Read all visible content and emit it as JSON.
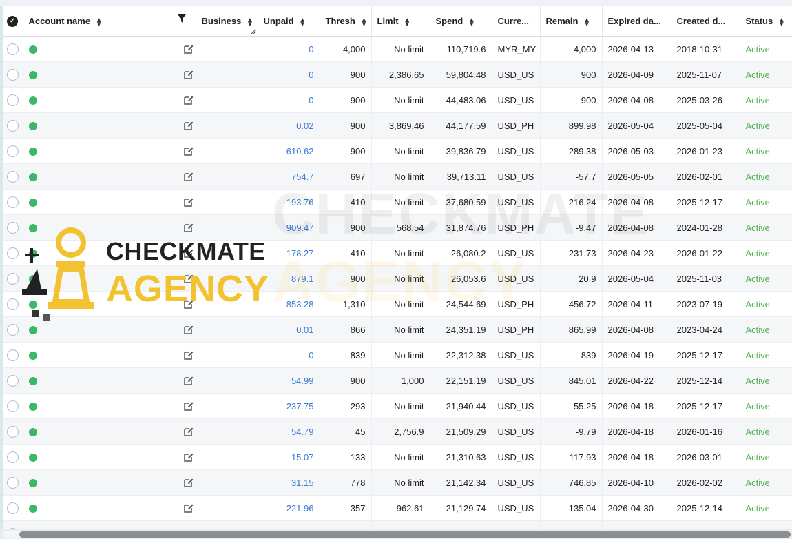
{
  "columns": {
    "select": "",
    "account_name": "Account name",
    "business": "Business",
    "unpaid": "Unpaid",
    "thresh": "Thresh",
    "limit": "Limit",
    "spend": "Spend",
    "currency": "Curre...",
    "remain": "Remain",
    "expired": "Expired da...",
    "created": "Created d...",
    "status": "Status"
  },
  "rows": [
    {
      "unpaid": "0",
      "thresh": "4,000",
      "limit": "No limit",
      "spend": "110,719.6",
      "currency": "MYR_MY",
      "remain": "4,000",
      "expired": "2026-04-13",
      "created": "2018-10-31",
      "status": "Active"
    },
    {
      "unpaid": "0",
      "thresh": "900",
      "limit": "2,386.65",
      "spend": "59,804.48",
      "currency": "USD_US",
      "remain": "900",
      "expired": "2026-04-09",
      "created": "2025-11-07",
      "status": "Active"
    },
    {
      "unpaid": "0",
      "thresh": "900",
      "limit": "No limit",
      "spend": "44,483.06",
      "currency": "USD_US",
      "remain": "900",
      "expired": "2026-04-08",
      "created": "2025-03-26",
      "status": "Active"
    },
    {
      "unpaid": "0.02",
      "thresh": "900",
      "limit": "3,869.46",
      "spend": "44,177.59",
      "currency": "USD_PH",
      "remain": "899.98",
      "expired": "2026-05-04",
      "created": "2025-05-04",
      "status": "Active"
    },
    {
      "unpaid": "610.62",
      "thresh": "900",
      "limit": "No limit",
      "spend": "39,836.79",
      "currency": "USD_US",
      "remain": "289.38",
      "expired": "2026-05-03",
      "created": "2026-01-23",
      "status": "Active"
    },
    {
      "unpaid": "754.7",
      "thresh": "697",
      "limit": "No limit",
      "spend": "39,713.11",
      "currency": "USD_US",
      "remain": "-57.7",
      "expired": "2026-05-05",
      "created": "2026-02-01",
      "status": "Active"
    },
    {
      "unpaid": "193.76",
      "thresh": "410",
      "limit": "No limit",
      "spend": "37,680.59",
      "currency": "USD_US",
      "remain": "216.24",
      "expired": "2026-04-08",
      "created": "2025-12-17",
      "status": "Active"
    },
    {
      "unpaid": "909.47",
      "thresh": "900",
      "limit": "568.54",
      "spend": "31,874.76",
      "currency": "USD_PH",
      "remain": "-9.47",
      "expired": "2026-04-08",
      "created": "2024-01-28",
      "status": "Active"
    },
    {
      "unpaid": "178.27",
      "thresh": "410",
      "limit": "No limit",
      "spend": "26,080.2",
      "currency": "USD_US",
      "remain": "231.73",
      "expired": "2026-04-23",
      "created": "2026-01-22",
      "status": "Active"
    },
    {
      "unpaid": "879.1",
      "thresh": "900",
      "limit": "No limit",
      "spend": "26,053.6",
      "currency": "USD_US",
      "remain": "20.9",
      "expired": "2026-05-04",
      "created": "2025-11-03",
      "status": "Active"
    },
    {
      "unpaid": "853.28",
      "thresh": "1,310",
      "limit": "No limit",
      "spend": "24,544.69",
      "currency": "USD_PH",
      "remain": "456.72",
      "expired": "2026-04-11",
      "created": "2023-07-19",
      "status": "Active"
    },
    {
      "unpaid": "0.01",
      "thresh": "866",
      "limit": "No limit",
      "spend": "24,351.19",
      "currency": "USD_PH",
      "remain": "865.99",
      "expired": "2026-04-08",
      "created": "2023-04-24",
      "status": "Active"
    },
    {
      "unpaid": "0",
      "thresh": "839",
      "limit": "No limit",
      "spend": "22,312.38",
      "currency": "USD_US",
      "remain": "839",
      "expired": "2026-04-19",
      "created": "2025-12-17",
      "status": "Active"
    },
    {
      "unpaid": "54.99",
      "thresh": "900",
      "limit": "1,000",
      "spend": "22,151.19",
      "currency": "USD_US",
      "remain": "845.01",
      "expired": "2026-04-22",
      "created": "2025-12-14",
      "status": "Active"
    },
    {
      "unpaid": "237.75",
      "thresh": "293",
      "limit": "No limit",
      "spend": "21,940.44",
      "currency": "USD_US",
      "remain": "55.25",
      "expired": "2026-04-18",
      "created": "2025-12-17",
      "status": "Active"
    },
    {
      "unpaid": "54.79",
      "thresh": "45",
      "limit": "2,756.9",
      "spend": "21,509.29",
      "currency": "USD_US",
      "remain": "-9.79",
      "expired": "2026-04-18",
      "created": "2026-01-16",
      "status": "Active"
    },
    {
      "unpaid": "15.07",
      "thresh": "133",
      "limit": "No limit",
      "spend": "21,310.63",
      "currency": "USD_US",
      "remain": "117.93",
      "expired": "2026-04-18",
      "created": "2026-03-01",
      "status": "Active"
    },
    {
      "unpaid": "31.15",
      "thresh": "778",
      "limit": "No limit",
      "spend": "21,142.34",
      "currency": "USD_US",
      "remain": "746.85",
      "expired": "2026-04-10",
      "created": "2026-02-02",
      "status": "Active"
    },
    {
      "unpaid": "221.96",
      "thresh": "357",
      "limit": "962.61",
      "spend": "21,129.74",
      "currency": "USD_US",
      "remain": "135.04",
      "expired": "2026-04-30",
      "created": "2025-12-14",
      "status": "Active"
    },
    {
      "unpaid": "",
      "thresh": "",
      "limit": "",
      "spend": "",
      "currency": "",
      "remain": "",
      "expired": "",
      "created": "",
      "status": ""
    }
  ],
  "watermark": {
    "line1": "CHECKMATE",
    "line2": "AGENCY"
  },
  "icons": {
    "select_all": "check-circle-icon",
    "sort": "sort-icon",
    "filter": "filter-icon",
    "edit": "edit-icon",
    "status_dot": "status-dot-icon"
  },
  "colors": {
    "status_active": "#4cb050",
    "status_dot": "#3cb769",
    "unpaid_link": "#3a7bd5",
    "watermark_yellow": "#f2c230"
  }
}
